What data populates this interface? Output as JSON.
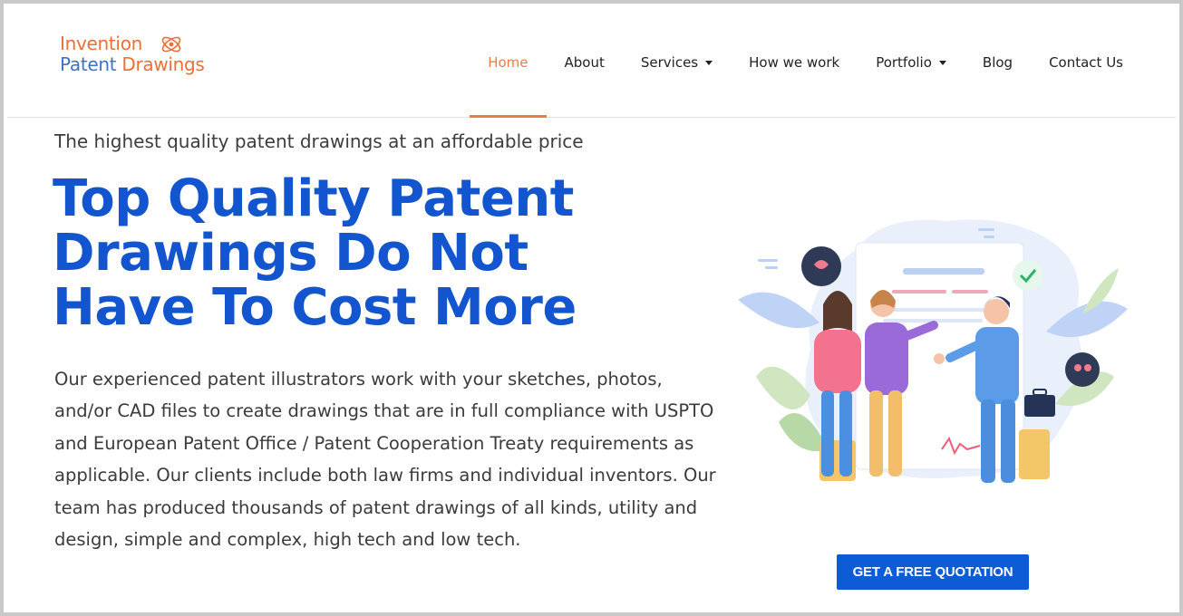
{
  "logo": {
    "line1": "Invention",
    "line2_part1": "Patent",
    "line2_part2": "Drawings",
    "colors": {
      "orange": "#ec6f37",
      "blue": "#3d73c7"
    }
  },
  "nav": {
    "items": [
      {
        "label": "Home",
        "active": true,
        "dropdown": false
      },
      {
        "label": "About",
        "active": false,
        "dropdown": false
      },
      {
        "label": "Services",
        "active": false,
        "dropdown": true
      },
      {
        "label": "How we work",
        "active": false,
        "dropdown": false
      },
      {
        "label": "Portfolio",
        "active": false,
        "dropdown": true
      },
      {
        "label": "Blog",
        "active": false,
        "dropdown": false
      },
      {
        "label": "Contact Us",
        "active": false,
        "dropdown": false
      }
    ],
    "active_color": "#ec7d45"
  },
  "hero": {
    "tagline": "The highest quality patent drawings at an affordable price",
    "headline": "Top Quality Patent Drawings Do Not Have To Cost More",
    "body": "Our experienced patent illustrators work with your sketches, photos, and/or CAD files to create drawings that are in full compliance with USPTO and European Patent Office / Patent Cooperation Treaty requirements as applicable. Our clients include both law firms and individual inventors. Our team has produced thousands of patent drawings of all kinds, utility and design, simple and complex, high tech and low tech.",
    "headline_color": "#1255cf",
    "illustration_icon": "business-handshake-illustration",
    "cta_label": "GET A FREE QUOTATION",
    "cta_color": "#0d5bd7"
  }
}
